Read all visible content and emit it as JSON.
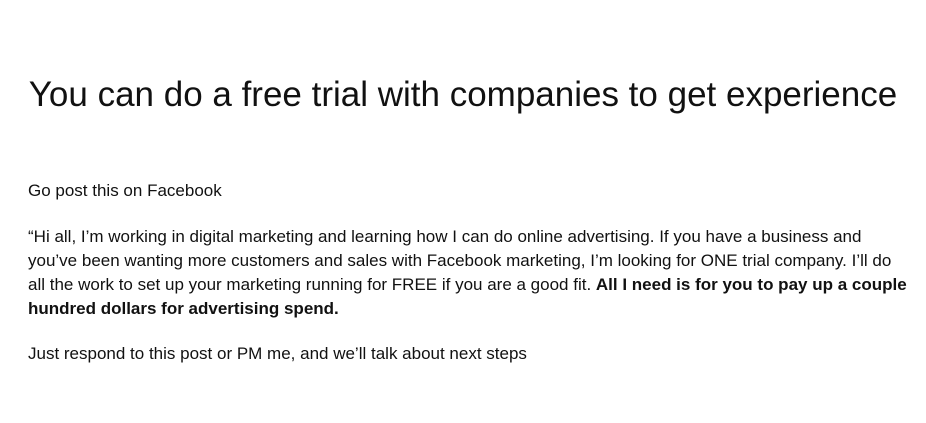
{
  "slide": {
    "title": "You can do a free trial with companies to get experience",
    "intro": "Go post this on Facebook",
    "quote_plain": "“Hi all, I’m working in digital marketing and learning how I can do online advertising. If you have a business and you’ve been wanting more customers and sales with Facebook marketing, I’m looking for ONE trial company. I’ll do all the work to set up your marketing running for FREE if you are a good fit. ",
    "quote_bold": "All I need is for you to pay up a couple hundred dollars for advertising spend.",
    "closing": "Just respond to this post or PM me, and we’ll talk about next steps"
  }
}
